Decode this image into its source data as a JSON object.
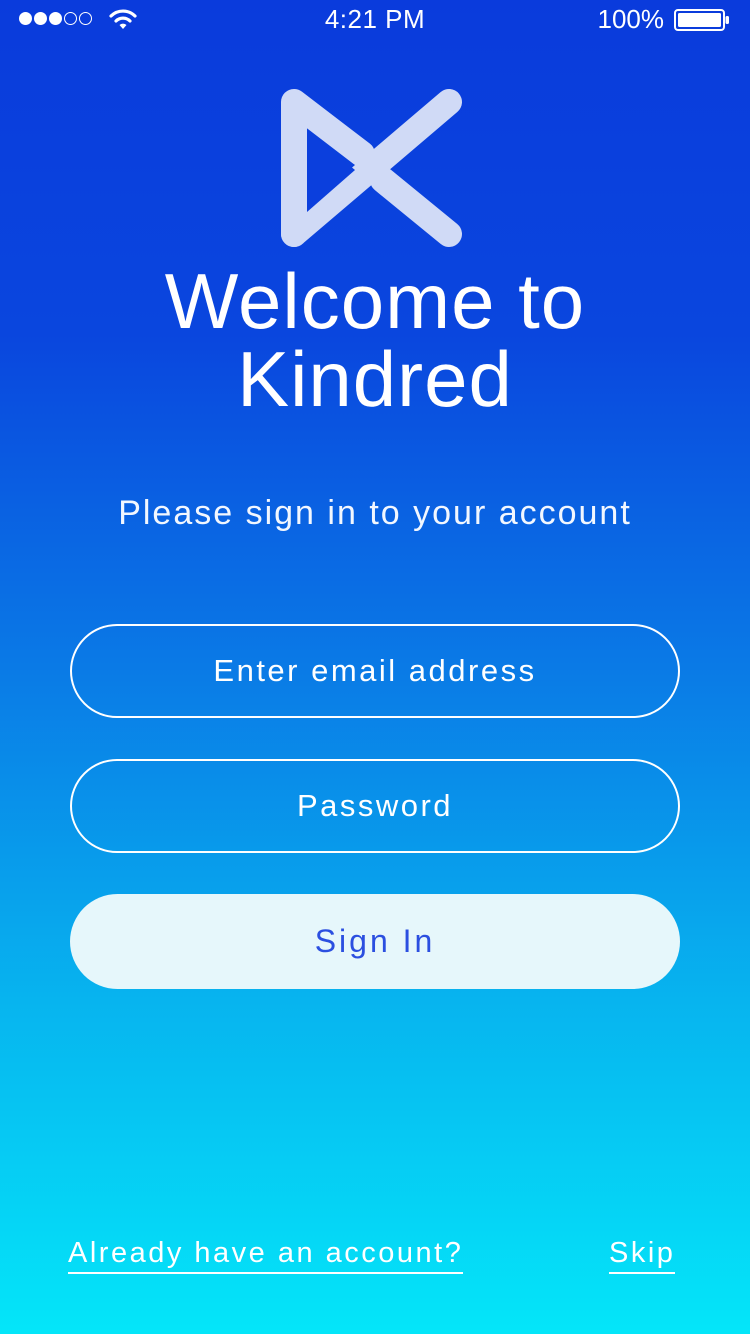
{
  "status_bar": {
    "signal_icon": "signal-dots-icon",
    "signal_filled": 3,
    "signal_total": 5,
    "wifi_icon": "wifi-icon",
    "time": "4:21 PM",
    "battery_percent": "100%",
    "battery_icon": "battery-full-icon",
    "battery_level": 1.0
  },
  "logo": {
    "icon": "kindred-logo-icon",
    "color": "#d0daf6"
  },
  "welcome": {
    "line1": "Welcome to",
    "line2": "Kindred"
  },
  "subtitle": "Please sign in to your account",
  "form": {
    "email_placeholder": "Enter email address",
    "email_value": "",
    "password_placeholder": "Password",
    "password_value": "",
    "signin_label": "Sign In"
  },
  "footer": {
    "account_link": "Already have an account?",
    "skip_link": "Skip"
  },
  "colors": {
    "gradient_top": "#0a3bdc",
    "gradient_bottom": "#04e6f9",
    "button_bg": "#e6f7fb",
    "button_text": "#2b4fe0"
  }
}
